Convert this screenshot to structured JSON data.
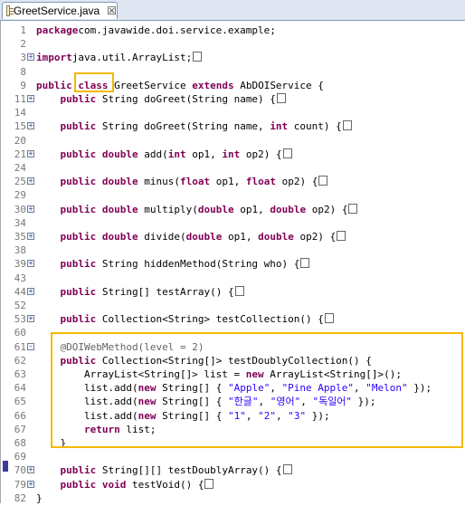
{
  "tab": {
    "title": "GreetService.java",
    "close": "☒",
    "icon": "java-file-icon"
  },
  "lines": [
    {
      "n": "1",
      "fold": "",
      "parts": [
        [
          "kw",
          "package"
        ],
        [
          "",
          "com.javawide.doi.service.example;"
        ]
      ]
    },
    {
      "n": "2",
      "fold": "",
      "parts": []
    },
    {
      "n": "3",
      "fold": "+",
      "parts": [
        [
          "kw",
          "import"
        ],
        [
          "",
          "java.util.ArrayList;"
        ]
      ],
      "collapsed": true
    },
    {
      "n": "8",
      "fold": "",
      "parts": []
    },
    {
      "n": "9",
      "fold": "",
      "parts": [
        [
          "kw",
          "public"
        ],
        [
          "",
          " "
        ],
        [
          "kw",
          "class"
        ],
        [
          "",
          " GreetService "
        ],
        [
          "kw",
          "extends"
        ],
        [
          "",
          " AbDOIService {"
        ]
      ]
    },
    {
      "n": "11",
      "fold": "+",
      "parts": [
        [
          "",
          "    "
        ],
        [
          "kw",
          "public"
        ],
        [
          "",
          " String doGreet(String name) {"
        ]
      ],
      "collapsed": true
    },
    {
      "n": "14",
      "fold": "",
      "parts": []
    },
    {
      "n": "15",
      "fold": "+",
      "parts": [
        [
          "",
          "    "
        ],
        [
          "kw",
          "public"
        ],
        [
          "",
          " String doGreet(String name, "
        ],
        [
          "kw",
          "int"
        ],
        [
          "",
          " count) {"
        ]
      ],
      "collapsed": true
    },
    {
      "n": "20",
      "fold": "",
      "parts": []
    },
    {
      "n": "21",
      "fold": "+",
      "parts": [
        [
          "",
          "    "
        ],
        [
          "kw",
          "public double"
        ],
        [
          "",
          " add("
        ],
        [
          "kw",
          "int"
        ],
        [
          "",
          " op1, "
        ],
        [
          "kw",
          "int"
        ],
        [
          "",
          " op2) {"
        ]
      ],
      "collapsed": true
    },
    {
      "n": "24",
      "fold": "",
      "parts": []
    },
    {
      "n": "25",
      "fold": "+",
      "parts": [
        [
          "",
          "    "
        ],
        [
          "kw",
          "public double"
        ],
        [
          "",
          " minus("
        ],
        [
          "kw",
          "float"
        ],
        [
          "",
          " op1, "
        ],
        [
          "kw",
          "float"
        ],
        [
          "",
          " op2) {"
        ]
      ],
      "collapsed": true
    },
    {
      "n": "29",
      "fold": "",
      "parts": []
    },
    {
      "n": "30",
      "fold": "+",
      "parts": [
        [
          "",
          "    "
        ],
        [
          "kw",
          "public double"
        ],
        [
          "",
          " multiply("
        ],
        [
          "kw",
          "double"
        ],
        [
          "",
          " op1, "
        ],
        [
          "kw",
          "double"
        ],
        [
          "",
          " op2) {"
        ]
      ],
      "collapsed": true
    },
    {
      "n": "34",
      "fold": "",
      "parts": []
    },
    {
      "n": "35",
      "fold": "+",
      "parts": [
        [
          "",
          "    "
        ],
        [
          "kw",
          "public double"
        ],
        [
          "",
          " divide("
        ],
        [
          "kw",
          "double"
        ],
        [
          "",
          " op1, "
        ],
        [
          "kw",
          "double"
        ],
        [
          "",
          " op2) {"
        ]
      ],
      "collapsed": true
    },
    {
      "n": "38",
      "fold": "",
      "parts": []
    },
    {
      "n": "39",
      "fold": "+",
      "parts": [
        [
          "",
          "    "
        ],
        [
          "kw",
          "public"
        ],
        [
          "",
          " String hiddenMethod(String who) {"
        ]
      ],
      "collapsed": true
    },
    {
      "n": "43",
      "fold": "",
      "parts": []
    },
    {
      "n": "44",
      "fold": "+",
      "parts": [
        [
          "",
          "    "
        ],
        [
          "kw",
          "public"
        ],
        [
          "",
          " String[] testArray() {"
        ]
      ],
      "collapsed": true
    },
    {
      "n": "52",
      "fold": "",
      "parts": []
    },
    {
      "n": "53",
      "fold": "+",
      "parts": [
        [
          "",
          "    "
        ],
        [
          "kw",
          "public"
        ],
        [
          "",
          " Collection<String> testCollection() {"
        ]
      ],
      "collapsed": true
    },
    {
      "n": "60",
      "fold": "",
      "parts": []
    },
    {
      "n": "61",
      "fold": "-",
      "parts": [
        [
          "",
          "    "
        ],
        [
          "ann",
          "@DOIWebMethod(level = 2)"
        ]
      ]
    },
    {
      "n": "62",
      "fold": "",
      "parts": [
        [
          "",
          "    "
        ],
        [
          "kw",
          "public"
        ],
        [
          "",
          " Collection<String[]> testDoublyCollection() {"
        ]
      ]
    },
    {
      "n": "63",
      "fold": "",
      "parts": [
        [
          "",
          "        ArrayList<String[]> list = "
        ],
        [
          "kw",
          "new"
        ],
        [
          "",
          " ArrayList<String[]>();"
        ]
      ]
    },
    {
      "n": "64",
      "fold": "",
      "parts": [
        [
          "",
          "        list.add("
        ],
        [
          "kw",
          "new"
        ],
        [
          "",
          " String[] { "
        ],
        [
          "str",
          "\"Apple\""
        ],
        [
          "",
          ", "
        ],
        [
          "str",
          "\"Pine Apple\""
        ],
        [
          "",
          ", "
        ],
        [
          "str",
          "\"Melon\""
        ],
        [
          "",
          " });"
        ]
      ]
    },
    {
      "n": "65",
      "fold": "",
      "parts": [
        [
          "",
          "        list.add("
        ],
        [
          "kw",
          "new"
        ],
        [
          "",
          " String[] { "
        ],
        [
          "str",
          "\"한글\""
        ],
        [
          "",
          ", "
        ],
        [
          "str",
          "\"영어\""
        ],
        [
          "",
          ", "
        ],
        [
          "str",
          "\"독일어\""
        ],
        [
          "",
          " });"
        ]
      ]
    },
    {
      "n": "66",
      "fold": "",
      "parts": [
        [
          "",
          "        list.add("
        ],
        [
          "kw",
          "new"
        ],
        [
          "",
          " String[] { "
        ],
        [
          "str",
          "\"1\""
        ],
        [
          "",
          ", "
        ],
        [
          "str",
          "\"2\""
        ],
        [
          "",
          ", "
        ],
        [
          "str",
          "\"3\""
        ],
        [
          "",
          " });"
        ]
      ]
    },
    {
      "n": "67",
      "fold": "",
      "parts": [
        [
          "",
          "        "
        ],
        [
          "kw",
          "return"
        ],
        [
          "",
          " list;"
        ]
      ]
    },
    {
      "n": "68",
      "fold": "",
      "parts": [
        [
          "",
          "    }"
        ]
      ]
    },
    {
      "n": "69",
      "fold": "",
      "parts": []
    },
    {
      "n": "70",
      "fold": "+",
      "parts": [
        [
          "",
          "    "
        ],
        [
          "kw",
          "public"
        ],
        [
          "",
          " String[][] testDoublyArray() {"
        ]
      ],
      "collapsed": true
    },
    {
      "n": "79",
      "fold": "+",
      "parts": [
        [
          "",
          "    "
        ],
        [
          "kw",
          "public void"
        ],
        [
          "",
          " testVoid() {"
        ]
      ],
      "collapsed": true
    },
    {
      "n": "82",
      "fold": "",
      "parts": [
        [
          "",
          "}"
        ]
      ]
    }
  ]
}
